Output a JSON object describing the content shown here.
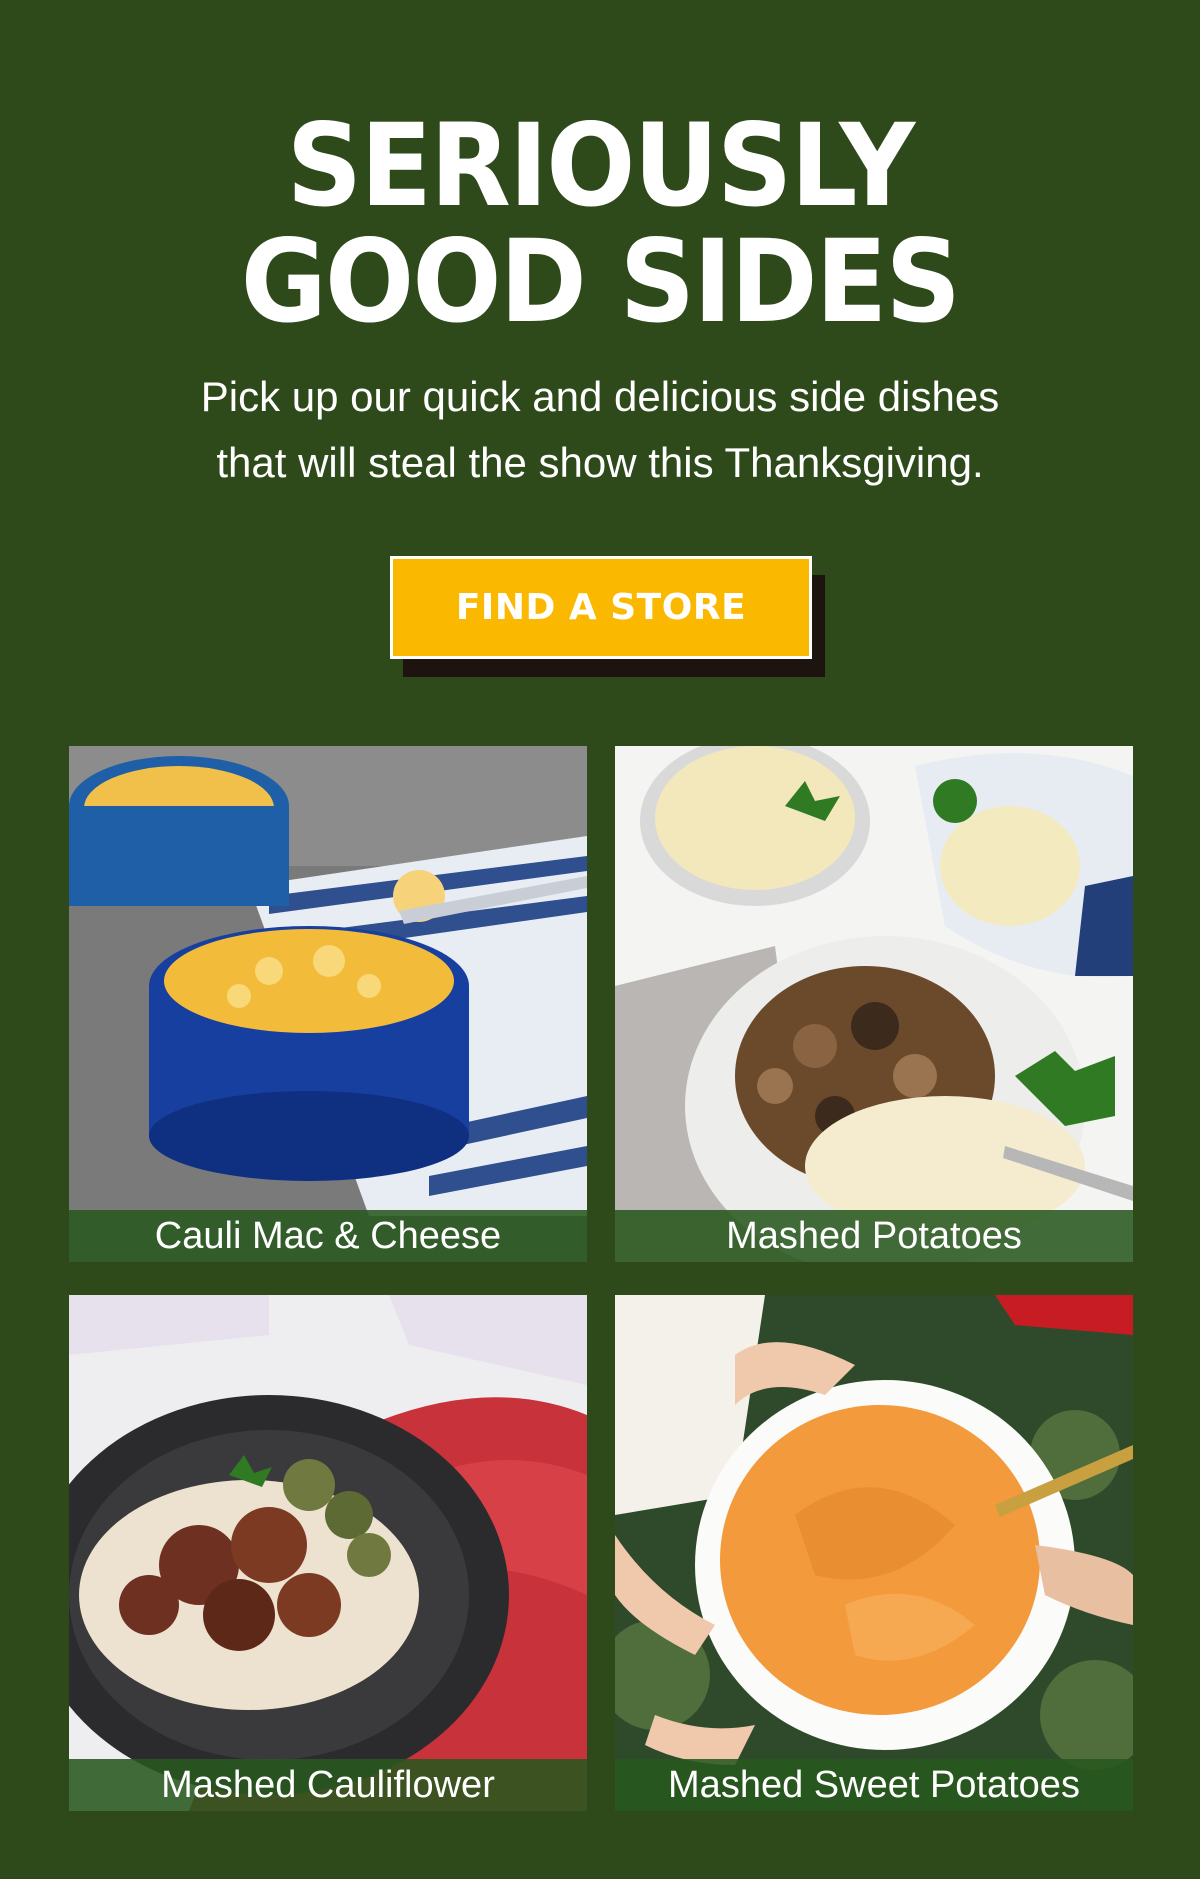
{
  "hero": {
    "title_line1": "SERIOUSLY",
    "title_line2": "GOOD SIDES",
    "subtitle_line1": "Pick up our quick and delicious side dishes",
    "subtitle_line2": "that will steal the show this Thanksgiving."
  },
  "cta": {
    "label": "FIND A STORE"
  },
  "products": [
    {
      "caption": "Cauli Mac & Cheese"
    },
    {
      "caption": "Mashed Potatoes"
    },
    {
      "caption": "Mashed Cauliflower"
    },
    {
      "caption": "Mashed Sweet Potatoes"
    }
  ],
  "colors": {
    "background": "#2e4a1a",
    "cta": "#fbb800",
    "caption_bar": "#28581e"
  }
}
